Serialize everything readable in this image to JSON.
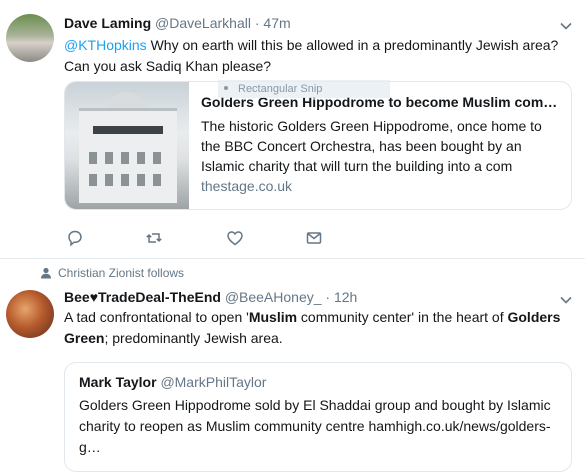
{
  "tweet1": {
    "name": "Dave Laming",
    "handle": "@DaveLarkhall",
    "separator": "·",
    "time": "47m",
    "mention": "@KTHopkins",
    "text_after_mention": " Why on earth will this be allowed in a predominantly Jewish area? Can you ask Sadiq Khan please?",
    "card": {
      "title": "Golders Green Hippodrome to become Muslim com…",
      "description": "The historic Golders Green Hippodrome, once home to the BBC Concert Orchestra, has been bought by an Islamic charity that will turn the building into a com",
      "domain": "thestage.co.uk"
    },
    "snip_overlay": "Rectangular Snip",
    "actions": [
      "reply-icon",
      "retweet-icon",
      "like-icon",
      "direct-message-icon"
    ]
  },
  "tweet2": {
    "context": "Christian Zionist follows",
    "name_part1": "Bee",
    "heart_glyph": "♥",
    "name_part2": "TradeDeal-TheEnd",
    "handle": "@BeeAHoney_",
    "separator": "·",
    "time": "12h",
    "text": {
      "p1": "A tad confrontational to open '",
      "b1": "Muslim",
      "p2": " community center' in the heart of ",
      "b2": "Golders Green",
      "p3": "; predominantly  Jewish area."
    },
    "quote": {
      "name": "Mark Taylor",
      "handle": "@MarkPhilTaylor",
      "text": "Golders Green Hippodrome sold by El Shaddai group and bought by Islamic charity to reopen as Muslim community centre hamhigh.co.uk/news/golders-g…"
    }
  },
  "colors": {
    "link": "#1da1f2",
    "muted": "#657786",
    "heart": "#e0245e",
    "border": "#e1e8ed"
  }
}
